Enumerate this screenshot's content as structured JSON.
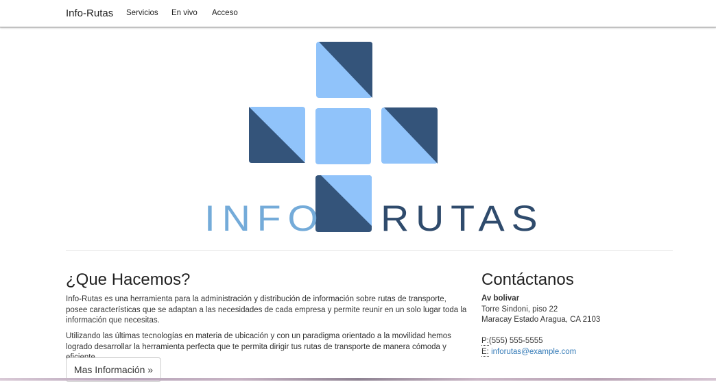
{
  "navbar": {
    "brand": "Info-Rutas",
    "links": [
      "Servicios",
      "En vivo",
      "Acceso"
    ]
  },
  "logo": {
    "text_left": "INFO",
    "text_right": "RUTAS",
    "colors": {
      "light": "#74abd9",
      "pale": "#90c3fa",
      "dark": "#34547a"
    }
  },
  "what": {
    "title": "¿Que Hacemos?",
    "paragraphs": [
      "Info-Rutas es una herramienta para la administración y distribución de información sobre rutas de transporte, posee características que se adaptan a las necesidades de cada empresa y permite reunir en un solo lugar toda la información que necesitas.",
      "Utilizando las últimas tecnologías en materia de ubicación y con un paradigma orientado a la movilidad hemos logrado desarrollar la herramienta perfecta que te permita dirigir tus rutas de transporte de manera cómoda y eficiente."
    ],
    "button_label": "Mas Información »"
  },
  "contact": {
    "title": "Contáctanos",
    "address_name": "Av bolivar",
    "address_line1": "Torre Sindoni, piso 22",
    "address_line2": "Maracay Estado Aragua, CA 2103",
    "phone_label": "P:",
    "phone": "(555) 555-5555",
    "email_label": "E:",
    "email": "inforutas@example.com"
  }
}
